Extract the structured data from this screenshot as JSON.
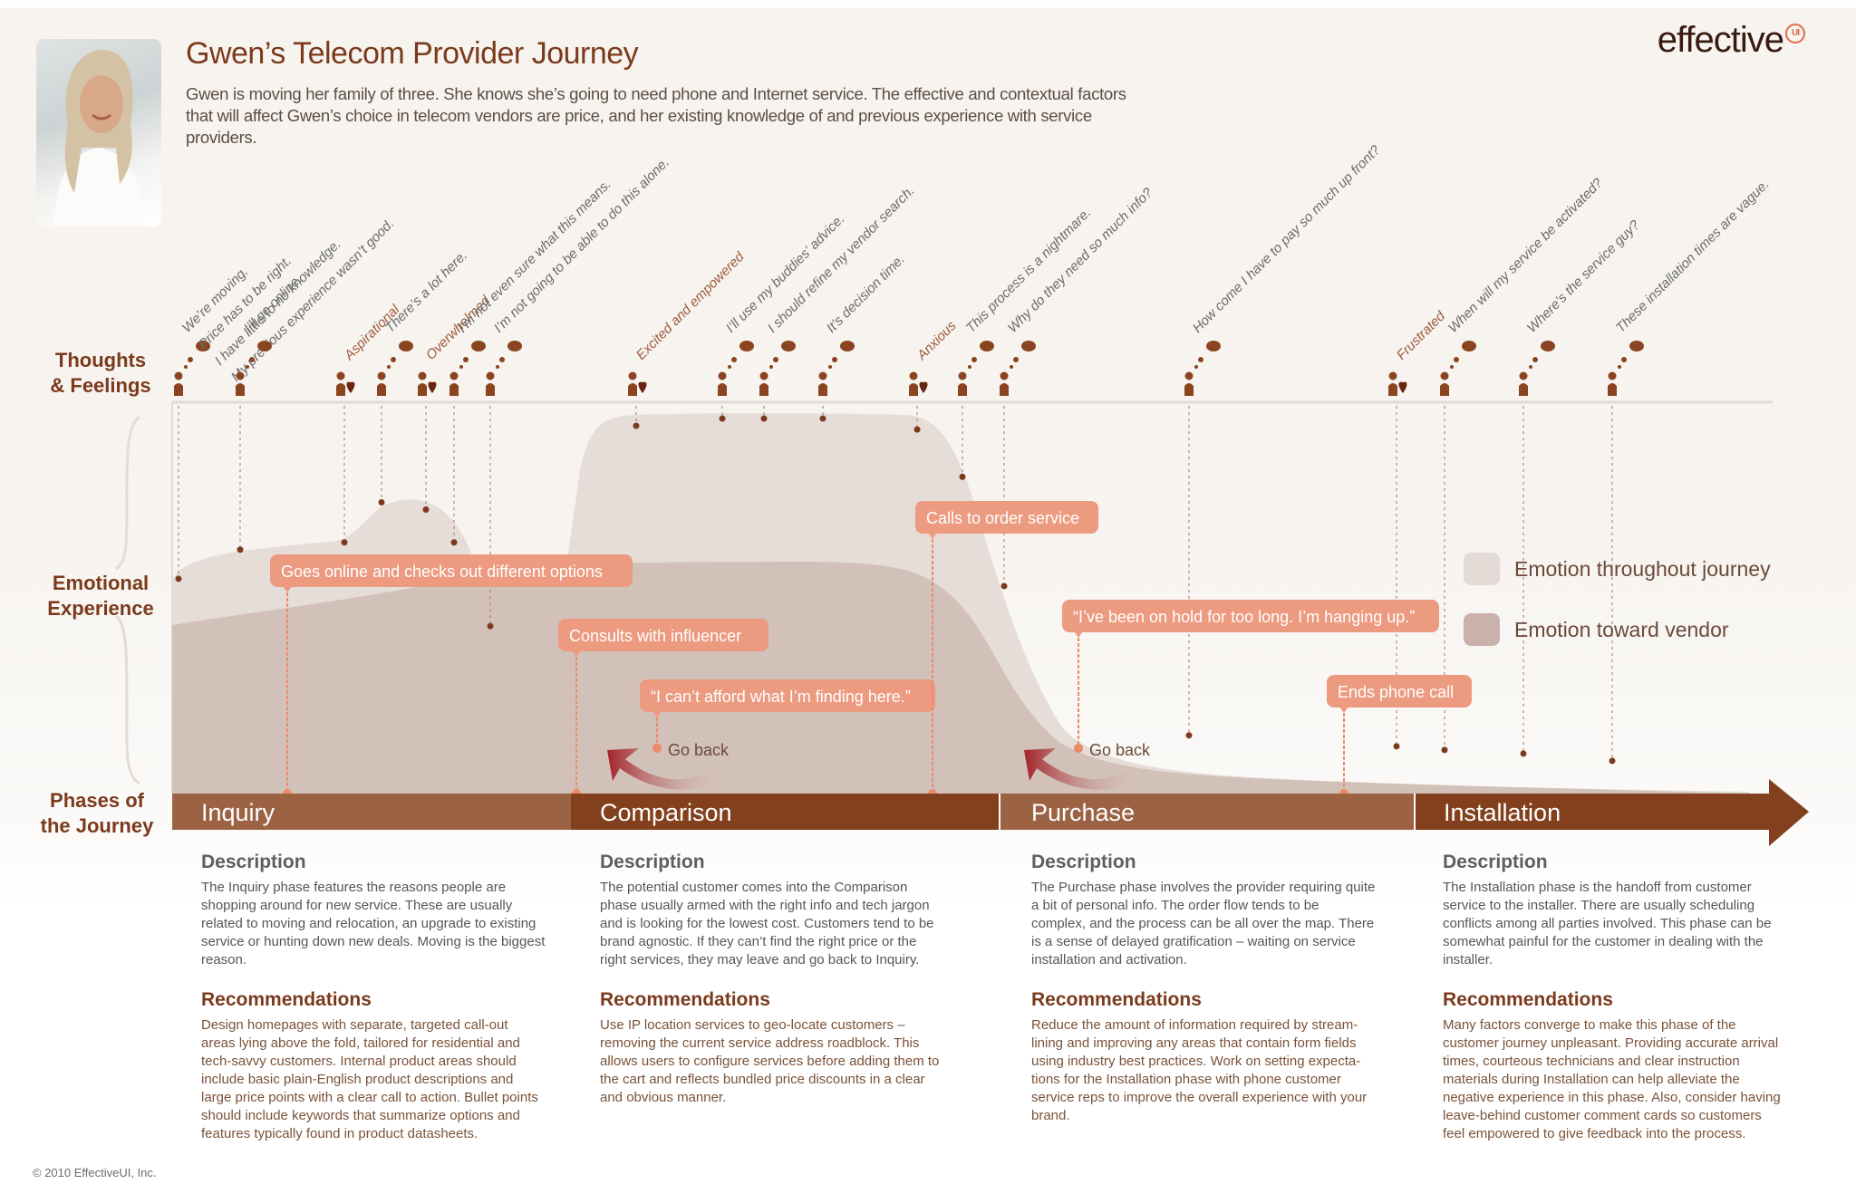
{
  "header": {
    "title": "Gwen’s Telecom Provider Journey",
    "intro": "Gwen is moving her family of three. She knows she’s going to need phone and Internet service. The effective and contextual factors that will affect Gwen’s choice in telecom vendors are price, and her existing knowledge of and previous experience with service providers.",
    "portrait_alt": "Portrait of Gwen",
    "logo_text": "effective",
    "logo_badge": "UI"
  },
  "row_labels": {
    "thoughts": [
      "Thoughts",
      "& Feelings"
    ],
    "emotional": [
      "Emotional",
      "Experience"
    ],
    "phases": [
      "Phases of",
      "the Journey"
    ]
  },
  "colors": {
    "brand_dark": "#7b3a1c",
    "phase_light": "#9c6244",
    "phase_dark": "#83401d",
    "callout": "#ec9a80",
    "emotion_throughout": "#e6ddd8",
    "emotion_vendor": "#cfbdb3",
    "icon": "#8a4520",
    "heart": "#6a2410"
  },
  "legend": [
    {
      "label": "Emotion throughout journey",
      "color": "#e4dbd7"
    },
    {
      "label": "Emotion toward vendor",
      "color": "#c9b2ab"
    }
  ],
  "thoughts_and_feelings": [
    {
      "type": "thought",
      "lines": [
        "We’re moving.",
        "Price has to be right.",
        "I have little to no knowledge.",
        "My previous experience wasn’t good."
      ],
      "phase": "Inquiry",
      "emotion": 0.54
    },
    {
      "type": "thought",
      "lines": [
        "I’ll go online."
      ],
      "phase": "Inquiry",
      "emotion": 0.62
    },
    {
      "type": "feeling",
      "lines": [
        "Aspirational"
      ],
      "phase": "Inquiry",
      "emotion": 0.64
    },
    {
      "type": "thought",
      "lines": [
        "There’s a lot here."
      ],
      "phase": "Inquiry",
      "emotion": 0.75
    },
    {
      "type": "feeling",
      "lines": [
        "Overwhelmed"
      ],
      "phase": "Inquiry",
      "emotion": 0.73
    },
    {
      "type": "thought",
      "lines": [
        "I’m not even sure what this means."
      ],
      "phase": "Inquiry",
      "emotion": 0.64
    },
    {
      "type": "thought",
      "lines": [
        "I’m not going to be able to do this alone."
      ],
      "phase": "Inquiry",
      "emotion": 0.41
    },
    {
      "type": "feeling",
      "lines": [
        "Excited and empowered"
      ],
      "phase": "Comparison",
      "emotion": 0.96
    },
    {
      "type": "thought",
      "lines": [
        "I’ll use my buddies’ advice."
      ],
      "phase": "Comparison",
      "emotion": 0.98
    },
    {
      "type": "thought",
      "lines": [
        "I should refine my vendor search."
      ],
      "phase": "Comparison",
      "emotion": 0.98
    },
    {
      "type": "thought",
      "lines": [
        "It’s decision time."
      ],
      "phase": "Comparison",
      "emotion": 0.98
    },
    {
      "type": "feeling",
      "lines": [
        "Anxious"
      ],
      "phase": "Comparison",
      "emotion": 0.95
    },
    {
      "type": "thought",
      "lines": [
        "This process is a nightmare."
      ],
      "phase": "Comparison",
      "emotion": 0.82
    },
    {
      "type": "thought",
      "lines": [
        "Why do they need so much info?"
      ],
      "phase": "Purchase",
      "emotion": 0.52
    },
    {
      "type": "thought",
      "lines": [
        "How come I have to pay so much up front?"
      ],
      "phase": "Purchase",
      "emotion": 0.11
    },
    {
      "type": "feeling",
      "lines": [
        "Frustrated"
      ],
      "phase": "Purchase",
      "emotion": 0.08
    },
    {
      "type": "thought",
      "lines": [
        "When will my service be activated?"
      ],
      "phase": "Installation",
      "emotion": 0.07
    },
    {
      "type": "thought",
      "lines": [
        "Where’s the service guy?"
      ],
      "phase": "Installation",
      "emotion": 0.06
    },
    {
      "type": "thought",
      "lines": [
        "These installation times are vague."
      ],
      "phase": "Installation",
      "emotion": 0.04
    }
  ],
  "callouts": [
    {
      "text": "Goes online and checks out different options"
    },
    {
      "text": "Consults with influencer"
    },
    {
      "text": "“I can’t afford what I’m finding here.”"
    },
    {
      "text": "Calls to order service"
    },
    {
      "text": "“I’ve been on hold for too long. I’m hanging up.”"
    },
    {
      "text": "Ends phone call"
    }
  ],
  "go_back_labels": [
    "Go back",
    "Go back"
  ],
  "phases": [
    {
      "name": "Inquiry",
      "description_heading": "Description",
      "description": "The Inquiry phase features the reasons people are shopping around for new service. These are usually related to moving and relocation, an upgrade to existing service or hunting down new deals. Moving is the biggest reason.",
      "recommendations_heading": "Recommendations",
      "recommendations": "Design homepages with separate, targeted call-out areas lying above the fold, tailored for residential and tech-savvy customers. Internal product areas should include basic plain-English product descriptions and large price points with a clear call to action. Bullet points should include keywords that summarize options and features typically found in product datasheets."
    },
    {
      "name": "Comparison",
      "description_heading": "Description",
      "description": "The potential customer comes into the Comparison phase usually armed with the right info and tech jargon and is looking for the lowest cost. Customers tend to be brand agnostic. If they can’t find the right price or the right services, they may leave and go back to Inquiry.",
      "recommendations_heading": "Recommendations",
      "recommendations": "Use IP location services to geo-locate customers – removing the current service address roadblock. This allows users to configure services before adding them to the cart and reflects bundled price discounts in a clear and obvious manner."
    },
    {
      "name": "Purchase",
      "description_heading": "Description",
      "description": "The Purchase phase involves the provider requiring quite a bit of personal info. The order flow tends to be complex, and the process can be all over the map. There is a sense of delayed gratification – waiting on service installation and activation.",
      "recommendations_heading": "Recommendations",
      "recommendations": "Reduce the amount of information required by stream-lining and improving any areas that contain form fields using industry best practices. Work on setting expecta-tions for the Installation phase with phone customer service reps to improve the overall experience with your brand."
    },
    {
      "name": "Installation",
      "description_heading": "Description",
      "description": "The Installation phase is the handoff from customer service to the installer. There are usually scheduling conflicts among all parties involved. This phase can be somewhat painful for the customer in dealing with the installer.",
      "recommendations_heading": "Recommendations",
      "recommendations": "Many factors converge to make this phase of the customer journey unpleasant. Providing accurate arrival times, courteous technicians and clear instruction materials during Installation can help alleviate the negative experience in this phase. Also, consider having leave-behind customer comment cards so customers feel empowered to give feedback into the process."
    }
  ],
  "footer": {
    "copyright": "© 2010 EffectiveUI, Inc."
  }
}
